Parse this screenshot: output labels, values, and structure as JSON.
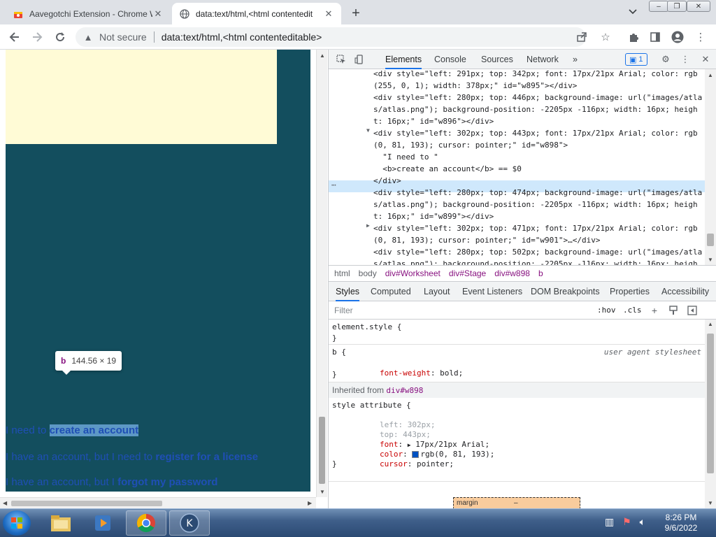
{
  "browser": {
    "tabs": [
      {
        "title": "Aavegotchi Extension - Chrome W",
        "active": false
      },
      {
        "title": "data:text/html,<html contentedit",
        "active": true
      }
    ],
    "new_tab": "+",
    "window": {
      "minimize": "–",
      "restore": "❐",
      "close": "✕"
    },
    "omnibox": {
      "security": "Not secure",
      "url": "data:text/html,<html contenteditable>"
    }
  },
  "page": {
    "tooltip": {
      "tag": "b",
      "dims": "144.56 × 19"
    },
    "lines": [
      {
        "prefix": "I need to ",
        "link": "create an account",
        "middle": "",
        "link2": ""
      },
      {
        "prefix": "I have an account, but I need to ",
        "link": "register for a license",
        "middle": "",
        "link2": ""
      },
      {
        "prefix": "I have an account, but I ",
        "link": "forgot my password",
        "middle": "",
        "link2": ""
      }
    ]
  },
  "devtools": {
    "tabs": [
      "Elements",
      "Console",
      "Sources",
      "Network"
    ],
    "more": "»",
    "issues_count": "1",
    "dom": [
      "<div style=\"left: 291px; top: 342px; font: 17px/21px Arial; color: rgb",
      "(255, 0, 1); width: 378px;\" id=\"w895\"></div>",
      "<div style=\"left: 280px; top: 446px; background-image: url(\"images/atla",
      "s/atlas.png\"); background-position: -2205px -116px; width: 16px; heigh",
      "t: 16px;\" id=\"w896\"></div>",
      "<div style=\"left: 302px; top: 443px; font: 17px/21px Arial; color: rgb",
      "(0, 81, 193); cursor: pointer;\" id=\"w898\">",
      "  \"I need to \"",
      "  <b>create an account</b> == $0",
      "</div>",
      "<div style=\"left: 280px; top: 474px; background-image: url(\"images/atla",
      "s/atlas.png\"); background-position: -2205px -116px; width: 16px; heigh",
      "t: 16px;\" id=\"w899\"></div>",
      "<div style=\"left: 302px; top: 471px; font: 17px/21px Arial; color: rgb",
      "(0, 81, 193); cursor: pointer;\" id=\"w901\">…</div>",
      "<div style=\"left: 280px; top: 502px; background-image: url(\"images/atla",
      "s/atlas.png\"); background-position: -2205px -116px; width: 16px; heigh"
    ],
    "breadcrumbs": [
      "html",
      "body",
      "div#Worksheet",
      "div#Stage",
      "div#w898",
      "b"
    ],
    "subtabs": [
      "Styles",
      "Computed",
      "Layout",
      "Event Listeners",
      "DOM Breakpoints",
      "Properties",
      "Accessibility"
    ],
    "filter_placeholder": "Filter",
    "hov": ":hov",
    "cls": ".cls",
    "styles": {
      "element_style": "element.style {",
      "close": "}",
      "b_selector": "b {",
      "ua_label": "user agent stylesheet",
      "b_prop": "font-weight",
      "b_val": "bold;",
      "inherited_label": "Inherited from",
      "inherited_tag": "div#w898",
      "style_attr": "style attribute {",
      "props": [
        {
          "name": "left",
          "value": "302px;",
          "dim": true
        },
        {
          "name": "top",
          "value": "443px;",
          "dim": true
        },
        {
          "name": "font",
          "value": "17px/21px Arial;",
          "dim": false
        },
        {
          "name": "color",
          "value": "rgb(0, 81, 193);",
          "dim": false
        },
        {
          "name": "cursor",
          "value": "pointer;",
          "dim": false
        }
      ],
      "box_margin": "margin",
      "box_dash": "–"
    }
  },
  "taskbar": {
    "time": "8:26 PM",
    "date": "9/6/2022"
  },
  "colors": {
    "worksheet_bg": "#134e5e",
    "paper_bg": "#fffbd6",
    "link_color": "#0051c1",
    "accent": "#1a73e8"
  }
}
